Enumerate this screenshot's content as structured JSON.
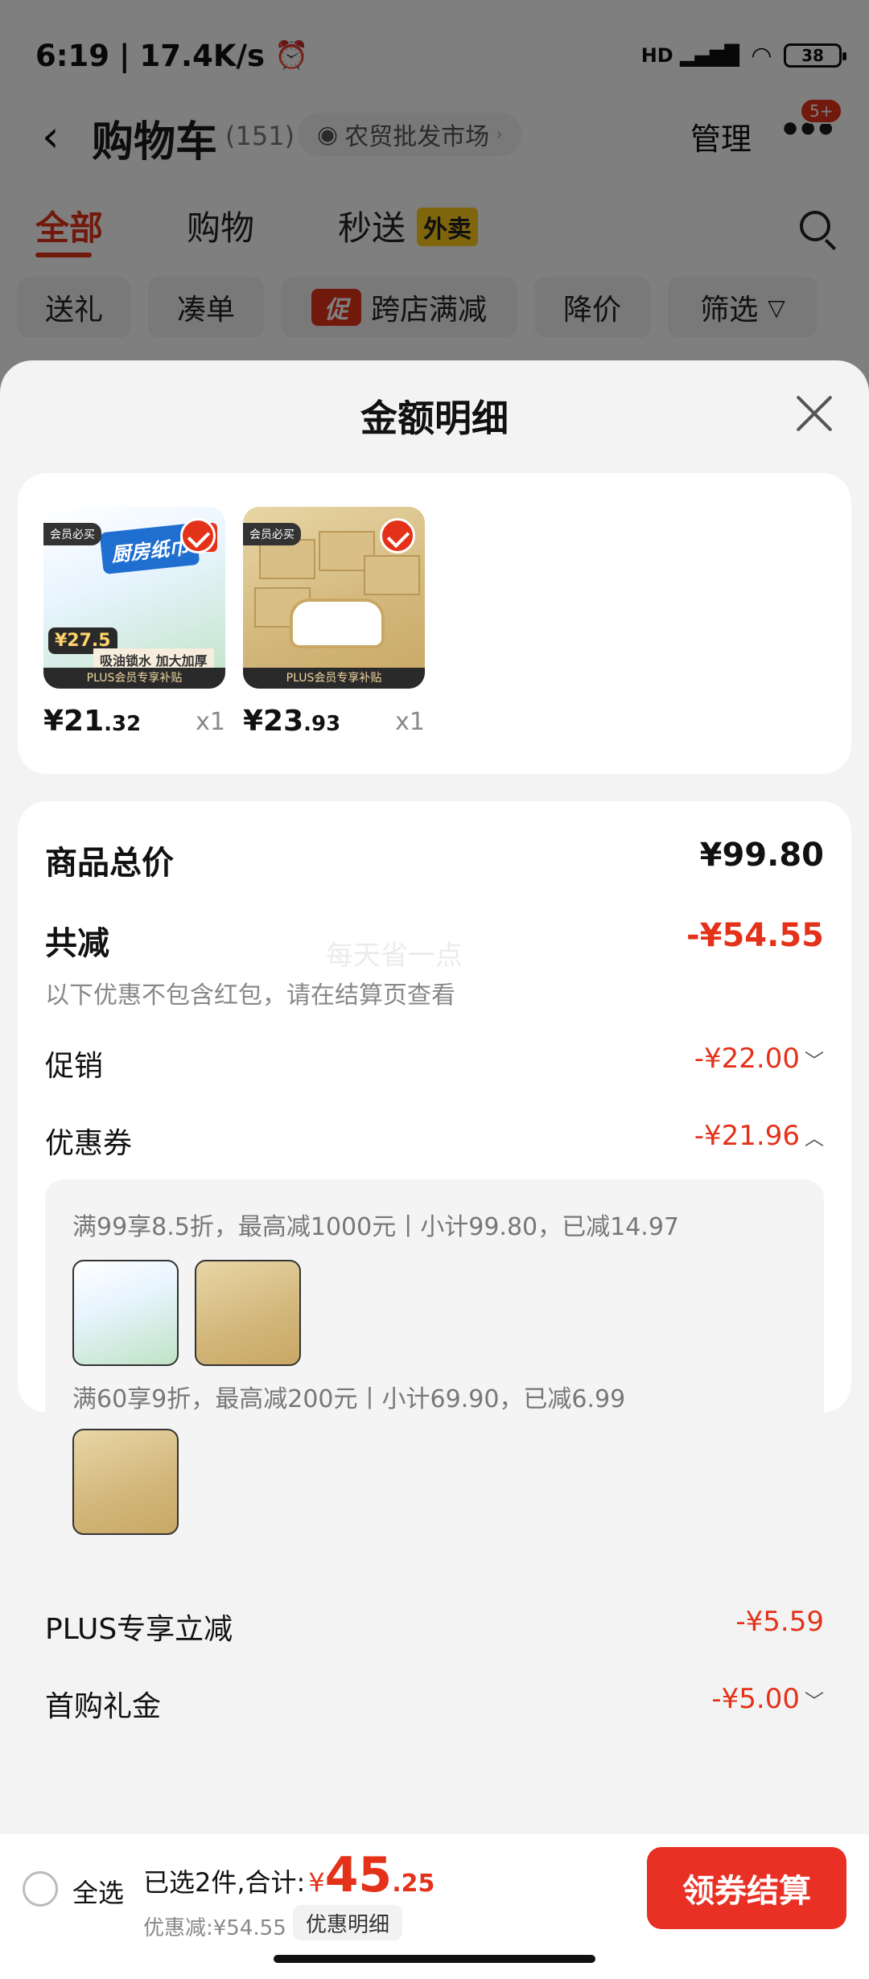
{
  "status": {
    "time": "6:19",
    "speed": "17.4K/s",
    "battery": "38",
    "network": "HD"
  },
  "header": {
    "title": "购物车",
    "count": "(151)",
    "market": "农贸批发市场",
    "manage": "管理",
    "badge": "5+"
  },
  "tabs": {
    "all": "全部",
    "shop": "购物",
    "fast": "秒送",
    "waimai": "外卖"
  },
  "chips": [
    "送礼",
    "凑单",
    "跨店满减",
    "降价",
    "筛选"
  ],
  "chip_icon": "促",
  "sheet": {
    "title": "金额明细",
    "products": [
      {
        "price_main": "¥21",
        "price_dec": ".32",
        "qty": "x1",
        "ribbon_top": "会员必买",
        "ribbon_bottom": "PLUS会员专享补贴",
        "banner": "厨房纸巾",
        "tag": "大",
        "art_price": "¥27.5",
        "slogan": "吸油锁水 加大加厚"
      },
      {
        "price_main": "¥23",
        "price_dec": ".93",
        "qty": "x1",
        "ribbon_top": "会员必买",
        "ribbon_bottom": "PLUS会员专享补贴"
      }
    ],
    "total_label": "商品总价",
    "total_value": "¥99.80",
    "reduce_label": "共减",
    "reduce_value": "-¥54.55",
    "reduce_note": "以下优惠不包含红包，请在结算页查看",
    "watermark": "每天省一点",
    "promo_label": "促销",
    "promo_value": "-¥22.00",
    "coupon_label": "优惠券",
    "coupon_value": "-¥21.96",
    "coupon_line1": "满99享8.5折，最高减1000元丨小计99.80，已减14.97",
    "coupon_line2": "满60享9折，最高减200元丨小计69.90，已减6.99",
    "plus_label": "PLUS专享立减",
    "plus_value": "-¥5.59",
    "first_label": "首购礼金",
    "first_value": "-¥5.00"
  },
  "bottom": {
    "select_all": "全选",
    "selected": "已选2件,合计:",
    "currency": "¥",
    "total_int": "45",
    "total_dec": ".25",
    "discount": "优惠减:¥54.55",
    "detail": "优惠明细",
    "checkout": "领券结算"
  },
  "colors": {
    "accent": "#e4321a",
    "checkout": "#e83025"
  }
}
